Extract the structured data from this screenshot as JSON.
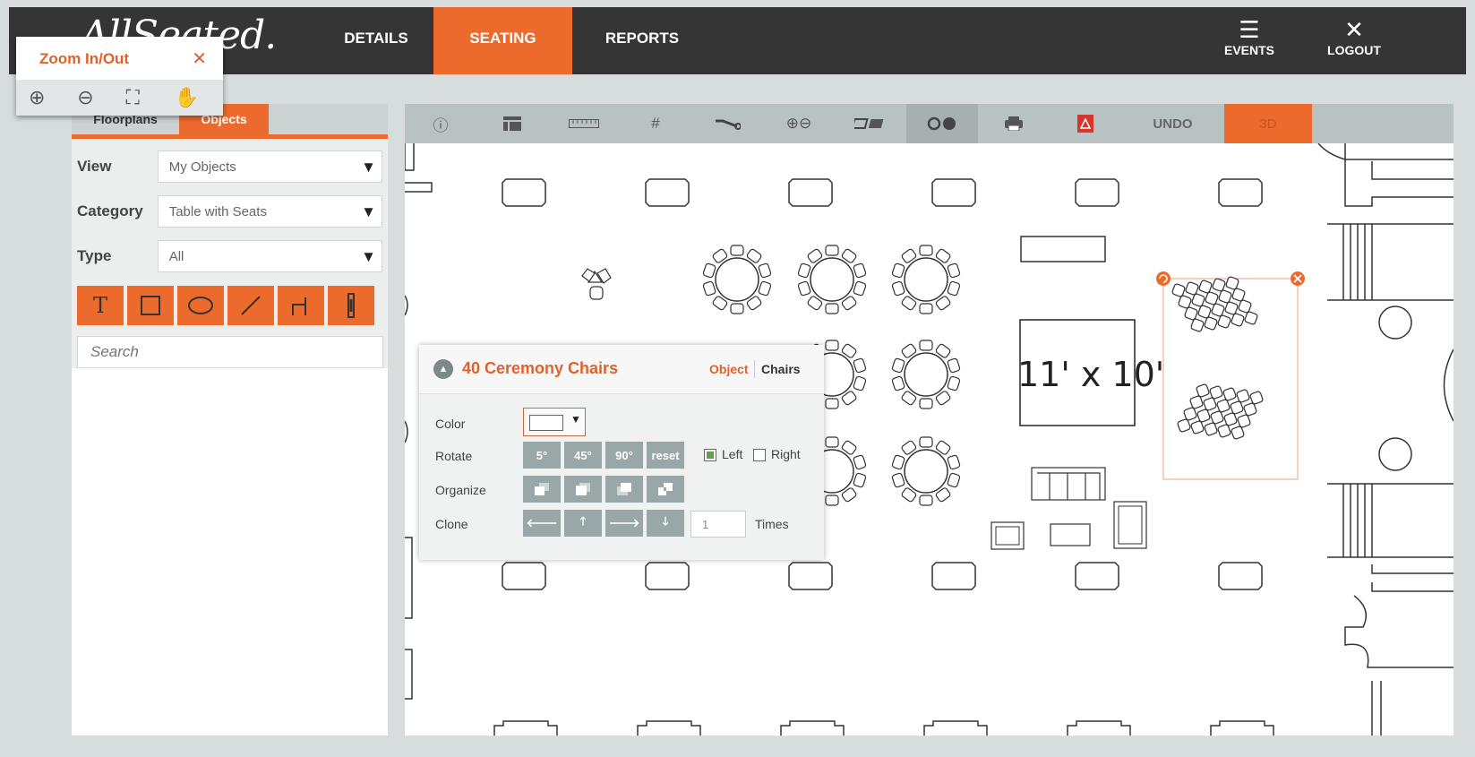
{
  "app": {
    "logo_text": "AllSeated."
  },
  "nav": {
    "tabs": [
      {
        "label": "DETAILS"
      },
      {
        "label": "SEATING"
      },
      {
        "label": "REPORTS"
      }
    ],
    "events_label": "EVENTS",
    "logout_label": "LOGOUT",
    "active_color": "#ec6a2c"
  },
  "zoom": {
    "title": "Zoom In/Out",
    "tools": [
      "zoom-in-icon",
      "zoom-out-icon",
      "fit-screen-icon",
      "pan-hand-icon"
    ]
  },
  "left_panel": {
    "tabs": [
      "Floorplans",
      "Objects"
    ],
    "active_tab": "Objects",
    "fields": {
      "view_label": "View",
      "view_value": "My Objects",
      "category_label": "Category",
      "category_value": "Table with Seats",
      "type_label": "Type",
      "type_value": "All"
    },
    "shape_tools": [
      "text-tool-icon",
      "rectangle-tool-icon",
      "ellipse-tool-icon",
      "line-tool-icon",
      "wall-tool-icon",
      "pillar-tool-icon"
    ],
    "search_placeholder": "Search"
  },
  "toolbar": {
    "tools": [
      "info-icon",
      "layout-icon",
      "ruler-icon",
      "grid-icon",
      "wrench-icon",
      "zoom-icon",
      "table-numbers-icon",
      "color-toggle-icon",
      "print-icon",
      "pdf-icon"
    ],
    "undo_label": "UNDO",
    "three_d_label": "3D"
  },
  "canvas": {
    "dimension_label": "11' x 10'"
  },
  "object_panel": {
    "title": "40 Ceremony Chairs",
    "tab_object": "Object",
    "tab_chairs": "Chairs",
    "color_label": "Color",
    "rotate_label": "Rotate",
    "rotate_buttons": [
      "5°",
      "45°",
      "90°",
      "reset"
    ],
    "left_label": "Left",
    "left_checked": true,
    "right_label": "Right",
    "right_checked": false,
    "organize_label": "Organize",
    "clone_label": "Clone",
    "clone_value": "1",
    "times_label": "Times"
  }
}
